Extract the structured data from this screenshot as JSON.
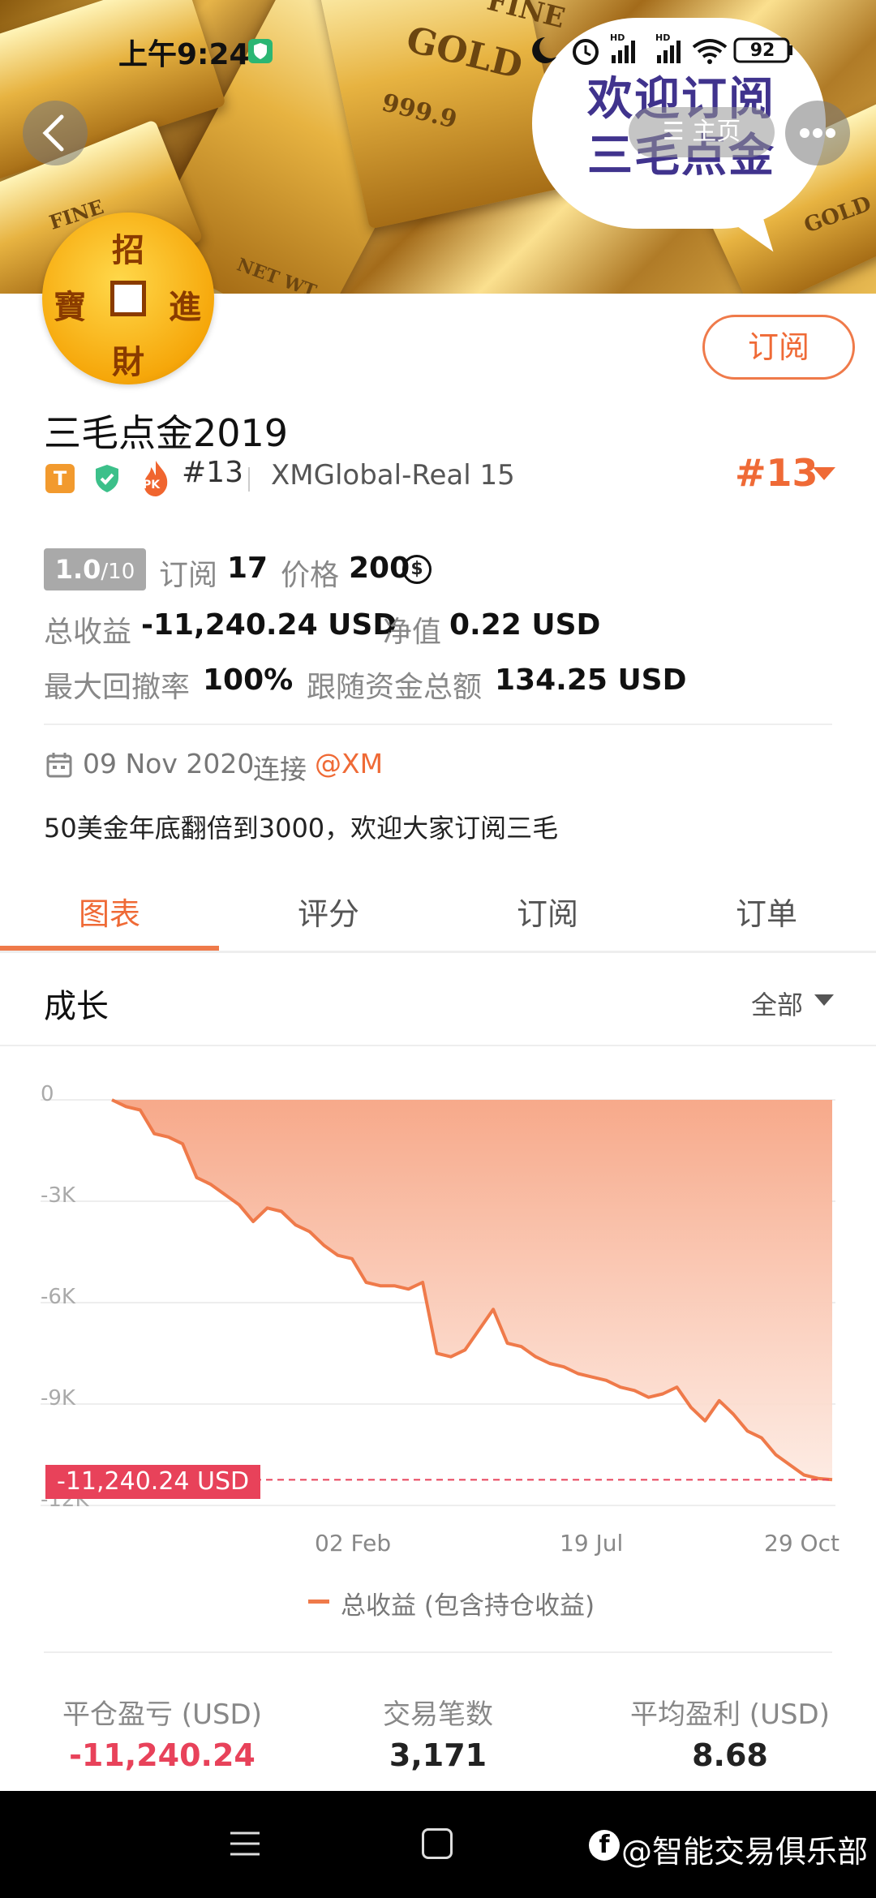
{
  "status_bar": {
    "time": "上午9:24",
    "battery": "92",
    "signal": "HD"
  },
  "banner": {
    "bar_texts": [
      "FINE",
      "GOLD",
      "999.9",
      "FINE",
      "NET WT",
      "GOLD"
    ],
    "bubble_line1": "欢迎订阅",
    "bubble_line2": "三毛点金",
    "home_label": "主页"
  },
  "avatar": {
    "top": "招",
    "left": "寶",
    "right": "進",
    "bottom": "財"
  },
  "profile": {
    "subscribe_label": "订阅",
    "name": "三毛点金2019",
    "badge_t": "T",
    "badge_pk": "PK",
    "rank": "#13",
    "server": "XMGlobal-Real 15",
    "rank_right": "#13"
  },
  "stats": {
    "rating_value": "1.0",
    "rating_scale": "/10",
    "subscribe_label": "订阅",
    "subscribe_count": "17",
    "price_label": "价格",
    "price_value": "200",
    "total_profit_label": "总收益",
    "total_profit_value": "-11,240.24 USD",
    "equity_label": "净值",
    "equity_value": "0.22 USD",
    "max_drawdown_label": "最大回撤率",
    "max_drawdown_value": "100%",
    "follow_amount_label": "跟随资金总额",
    "follow_amount_value": "134.25 USD"
  },
  "info": {
    "date": "09 Nov 2020",
    "connect_label": "连接",
    "broker": "@XM",
    "description": "50美金年底翻倍到3000，欢迎大家订阅三毛"
  },
  "tabs": [
    "图表",
    "评分",
    "订阅",
    "订单"
  ],
  "growth": {
    "title": "成长",
    "filter": "全部"
  },
  "chart_data": {
    "type": "area",
    "y_ticks": [
      "0",
      "-3K",
      "-6K",
      "-9K",
      "-12K"
    ],
    "x_ticks": [
      "02 Feb",
      "19 Jul",
      "29 Oct"
    ],
    "ylim": [
      -12000,
      0
    ],
    "current_label": "-11,240.24 USD",
    "current_value": -11240.24,
    "legend": "总收益 (包含持仓收益)",
    "series": [
      {
        "name": "总收益 (包含持仓收益)",
        "values": [
          0,
          -200,
          -300,
          -1000,
          -1100,
          -1300,
          -2300,
          -2500,
          -2800,
          -3100,
          -3600,
          -3200,
          -3300,
          -3700,
          -3900,
          -4300,
          -4600,
          -4700,
          -5400,
          -5500,
          -5500,
          -5600,
          -5400,
          -7500,
          -7600,
          -7400,
          -6800,
          -6200,
          -7200,
          -7300,
          -7600,
          -7800,
          -7900,
          -8100,
          -8200,
          -8300,
          -8500,
          -8600,
          -8800,
          -8700,
          -8500,
          -9100,
          -9500,
          -8900,
          -9300,
          -9800,
          -10000,
          -10500,
          -10800,
          -11100,
          -11200,
          -11240
        ]
      }
    ]
  },
  "summary": [
    {
      "label": "平仓盈亏 (USD)",
      "value": "-11,240.24"
    },
    {
      "label": "交易笔数",
      "value": "3,171"
    },
    {
      "label": "平均盈利 (USD)",
      "value": "8.68"
    }
  ],
  "watermark": "@智能交易俱乐部",
  "colors": {
    "accent": "#ef6a36",
    "negative": "#e8425a",
    "area_top": "#f7a98a"
  }
}
